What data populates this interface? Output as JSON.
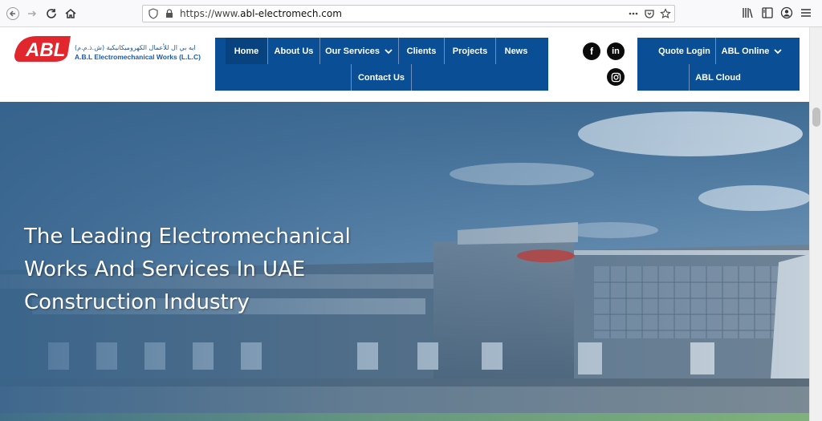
{
  "browser": {
    "url_scheme": "https://www.",
    "url_host": "abl-electromech.com",
    "icons": [
      "back-icon",
      "forward-icon",
      "reload-icon",
      "home-icon",
      "shield-icon",
      "lock-icon",
      "more-icon",
      "pocket-icon",
      "star-icon",
      "library-icon",
      "sidebar-icon",
      "account-icon",
      "menu-icon"
    ]
  },
  "logo": {
    "brand": "ABL",
    "arabic": "ايه بي ال للأعمال الكهروميكانيكية (ش.ذ.م.م)",
    "english": "A.B.L Electromechanical Works (L.L.C)"
  },
  "nav": {
    "home": "Home",
    "about": "About Us",
    "services": "Our Services",
    "clients": "Clients",
    "projects": "Projects",
    "news": "News",
    "contact": "Contact Us"
  },
  "nav2": {
    "quote": "Quote Login",
    "online": "ABL Online",
    "cloud": "ABL Cloud"
  },
  "social": {
    "facebook": "f",
    "linkedin": "in"
  },
  "hero": {
    "headline": "The Leading Electromechanical Works And Services In UAE Construction Industry"
  },
  "colors": {
    "nav_blue": "#0a4e96",
    "logo_red": "#e2262e",
    "logo_blue": "#1c5aa6"
  }
}
